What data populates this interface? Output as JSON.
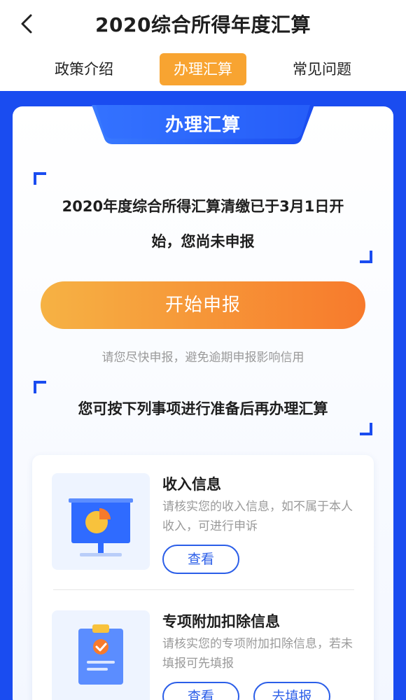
{
  "header": {
    "title": "2020综合所得年度汇算"
  },
  "tabs": [
    {
      "label": "政策介绍",
      "active": false
    },
    {
      "label": "办理汇算",
      "active": true
    },
    {
      "label": "常见问题",
      "active": false
    }
  ],
  "card": {
    "banner": "办理汇算",
    "notice_line1": "2020年度综合所得汇算清缴已于3月1日开",
    "notice_line2": "始，您尚未申报",
    "start_button": "开始申报",
    "hint": "请您尽快申报，避免逾期申报影响信用",
    "prepare_text": "您可按下列事项进行准备后再办理汇算"
  },
  "items": [
    {
      "title": "收入信息",
      "desc": "请核实您的收入信息，如不属于本人收入，可进行申诉",
      "view_label": "查看"
    },
    {
      "title": "专项附加扣除信息",
      "desc": "请核实您的专项附加扣除信息，若未填报可先填报",
      "view_label": "查看",
      "fill_label": "去填报"
    }
  ],
  "colors": {
    "brand_blue": "#1a4cf0",
    "accent_orange": "#f8a431",
    "button_gradient_start": "#f6b244",
    "button_gradient_end": "#f77a2c"
  }
}
